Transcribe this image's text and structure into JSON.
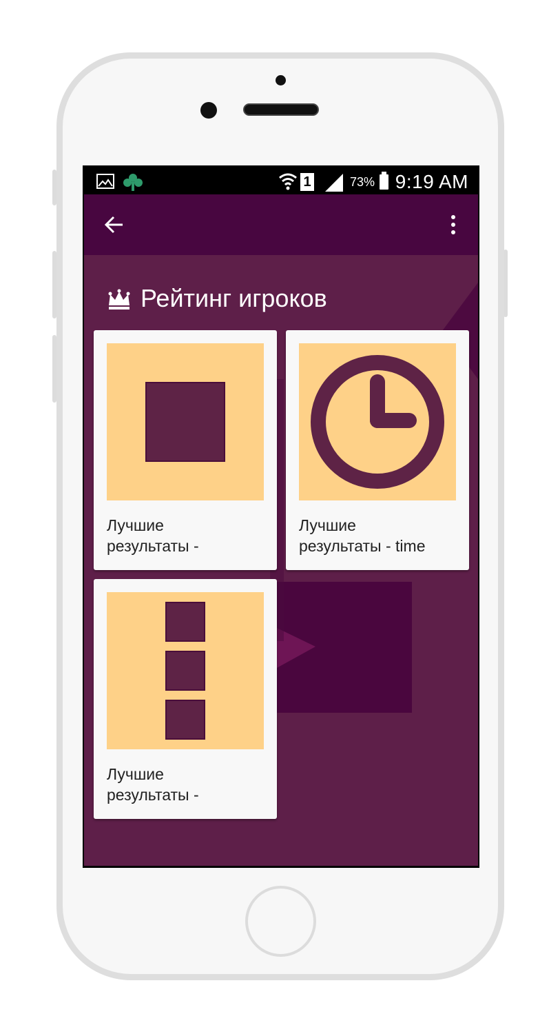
{
  "status_bar": {
    "battery_percent": "73%",
    "time": "9:19 AM",
    "sim_slot": "1",
    "icons": [
      "image-icon",
      "clover-notification-icon",
      "wifi-icon",
      "sim-icon",
      "signal-icon",
      "battery-icon"
    ]
  },
  "toolbar": {
    "back_icon": "arrow-left-icon",
    "menu_icon": "more-vert-icon"
  },
  "section": {
    "icon": "crown-icon",
    "title": "Рейтинг игроков"
  },
  "leaderboards": [
    {
      "title": "Лучшие\nрезультаты -",
      "icon": "square-icon"
    },
    {
      "title": "Лучшие\nрезультаты - time",
      "icon": "clock-icon"
    },
    {
      "title": "Лучшие\nрезультаты -",
      "icon": "stacked-squares-icon"
    }
  ],
  "colors": {
    "toolbar": "#480640",
    "background": "#5e1f49",
    "card": "#f8f8f8",
    "tile": "#fed188",
    "glyph": "#5e2346"
  }
}
